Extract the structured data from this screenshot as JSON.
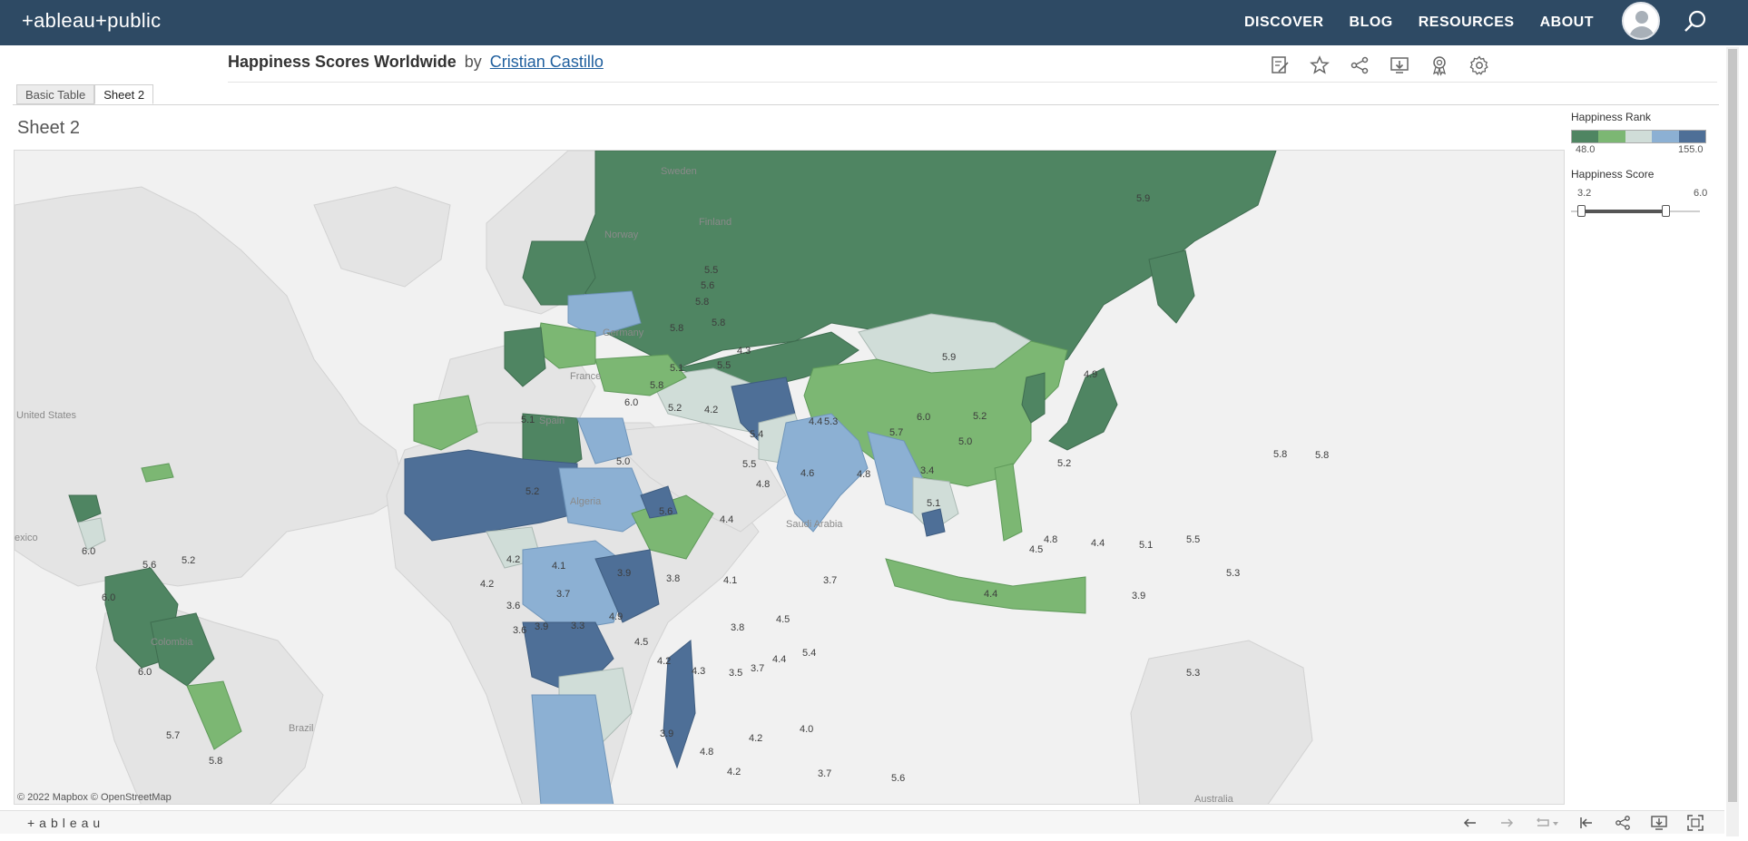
{
  "nav": {
    "logo": "+ableau+public",
    "links": [
      "DISCOVER",
      "BLOG",
      "RESOURCES",
      "ABOUT"
    ]
  },
  "header": {
    "title": "Happiness Scores Worldwide",
    "by": "by",
    "author": "Cristian Castillo"
  },
  "tabs": [
    "Basic Table",
    "Sheet 2"
  ],
  "active_tab": "Sheet 2",
  "sheet": {
    "title": "Sheet 2"
  },
  "legend": {
    "rank_title": "Happiness Rank",
    "rank_min": "48.0",
    "rank_max": "155.0",
    "rank_colors": [
      "#4f8562",
      "#7cb773",
      "#d0ddd8",
      "#8cb0d3",
      "#4e6f97"
    ],
    "score_title": "Happiness Score",
    "score_min": "3.2",
    "score_max": "6.0"
  },
  "attribution": "© 2022 Mapbox © OpenStreetMap",
  "footer": {
    "brand": "+ableau"
  },
  "colors": {
    "nav_bg": "#2e4a64",
    "dark_green": "#4f8562",
    "mid_green": "#7cb773",
    "neutral": "#d0ddd8",
    "light_blue": "#8cb0d3",
    "dark_blue": "#4e6f97"
  },
  "map": {
    "geo_labels": [
      "Sweden",
      "Finland",
      "Norway",
      "Germany",
      "France",
      "Spain",
      "United States",
      "Algeria",
      "Saudi Arabia",
      "Colombia",
      "Brazil",
      "Australia",
      "exico"
    ],
    "value_labels": [
      "5.9",
      "5.5",
      "5.6",
      "5.8",
      "5.8",
      "5.8",
      "4.3",
      "5.1",
      "5.5",
      "5.9",
      "6.0",
      "5.8",
      "5.2",
      "4.2",
      "5.1",
      "4.4",
      "5.3",
      "5.4",
      "5.7",
      "6.0",
      "5.2",
      "5.0",
      "5.0",
      "5.5",
      "5.2",
      "4.8",
      "4.6",
      "4.8",
      "3.4",
      "5.1",
      "4.9",
      "5.2",
      "5.6",
      "4.4",
      "4.2",
      "4.1",
      "3.9",
      "3.8",
      "4.1",
      "3.7",
      "4.2",
      "3.7",
      "3.6",
      "3.6",
      "3.9",
      "3.3",
      "4.9",
      "3.8",
      "4.5",
      "4.5",
      "5.4",
      "4.4",
      "4.2",
      "4.3",
      "3.5",
      "3.7",
      "4.4",
      "3.9",
      "4.8",
      "4.2",
      "4.2",
      "4.0",
      "3.7",
      "5.6",
      "4.8",
      "4.5",
      "4.4",
      "5.1",
      "5.5",
      "3.9",
      "5.3",
      "5.3",
      "5.8",
      "5.8",
      "6.0",
      "5.6",
      "5.2",
      "6.0",
      "6.0",
      "5.7",
      "5.8"
    ]
  }
}
